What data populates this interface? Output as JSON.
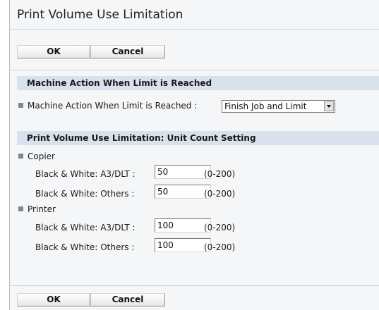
{
  "page": {
    "title": "Print Volume Use Limitation"
  },
  "buttons": {
    "ok_label": "OK",
    "cancel_label": "Cancel"
  },
  "machine_action": {
    "heading": "Machine Action When Limit is Reached",
    "field_label": "Machine Action When Limit is Reached :",
    "selected_value": "Finish Job and Limit"
  },
  "unit_count": {
    "heading": "Print Volume Use Limitation: Unit Count Setting",
    "copier": {
      "label": "Copier",
      "a3_label": "Black & White: A3/DLT :",
      "a3_value": "50",
      "others_label": "Black & White: Others :",
      "others_value": "50"
    },
    "printer": {
      "label": "Printer",
      "a3_label": "Black & White: A3/DLT :",
      "a3_value": "100",
      "others_label": "Black & White: Others :",
      "others_value": "100"
    },
    "range_text": "(0-200)"
  },
  "colors": {
    "section_header_bg": "#d9e1ec",
    "panel_bg": "#f5f6f8",
    "bullet": "#7e8792"
  }
}
